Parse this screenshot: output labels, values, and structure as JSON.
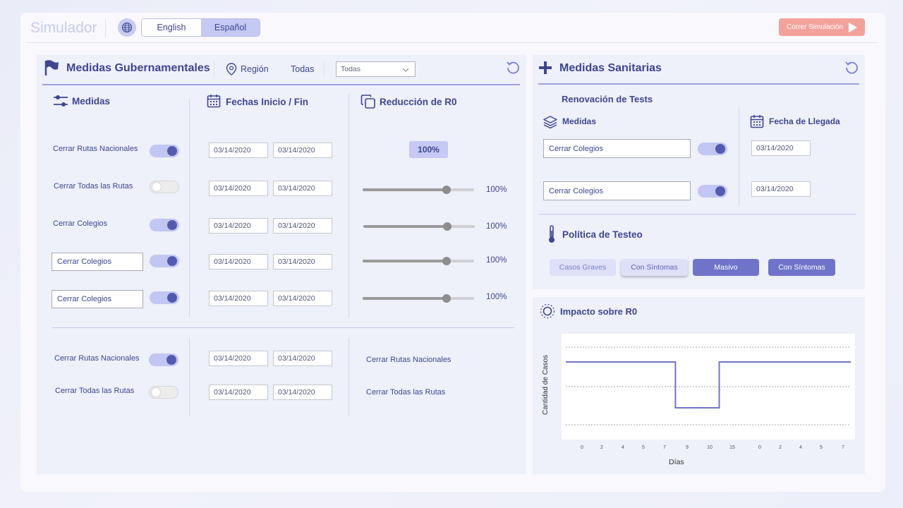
{
  "header": {
    "app_title": "Simulador",
    "language_options": [
      "English",
      "Español"
    ],
    "selected_language": "Español",
    "run_button_label": "Correr Simulación"
  },
  "gov": {
    "title": "Medidas Gubernamentales",
    "region_label": "Región",
    "region_value": "Todas",
    "region_select_value": "Todas",
    "col_measures": "Medidas",
    "col_dates": "Fechas Inicio / Fin",
    "col_reduction": "Reducción de R0",
    "rows": [
      {
        "label": "Cerrar Rutas Nacionales",
        "toggle": "on",
        "start": "03/14/2020",
        "end": "03/14/2020",
        "pct_badge": "100%"
      },
      {
        "label": "Cerrar Todas las Rutas",
        "toggle": "off",
        "start": "03/14/2020",
        "end": "03/14/2020",
        "slider": 0.75,
        "pct": "100%"
      },
      {
        "label": "Cerrar Colegios",
        "toggle": "on",
        "start": "03/14/2020",
        "end": "03/14/2020",
        "slider": 0.75,
        "pct": "100%"
      },
      {
        "input_value": "Cerrar Colegios",
        "toggle": "on",
        "start": "03/14/2020",
        "end": "03/14/2020",
        "slider": 0.75,
        "pct": "100%"
      },
      {
        "input_value": "Cerrar Colegios",
        "toggle": "on",
        "start": "03/14/2020",
        "end": "03/14/2020",
        "slider": 0.75,
        "pct": "100%"
      }
    ],
    "bottom_rows": [
      {
        "label": "Cerrar Rutas Nacionales",
        "toggle": "on",
        "start": "03/14/2020",
        "end": "03/14/2020",
        "right_label": "Cerrar Rutas Nacionales"
      },
      {
        "label": "Cerrar Todas las Rutas",
        "toggle": "off",
        "start": "03/14/2020",
        "end": "03/14/2020",
        "right_label": "Cerrar Todas las Rutas"
      }
    ]
  },
  "health": {
    "title": "Medidas Sanitarias",
    "subtitle": "Renovación de Tests",
    "col_measures": "Medidas",
    "col_date": "Fecha de Llegada",
    "rows": [
      {
        "input_value": "Cerrar Colegios",
        "toggle": "on",
        "date": "03/14/2020"
      },
      {
        "input_value": "Cerrar Colegios",
        "toggle": "on",
        "date": "03/14/2020"
      }
    ],
    "policy_title": "Política de Testeo",
    "policy_buttons": [
      "Casos Graves",
      "Con Síntomas",
      "Masivo",
      "Con Síntomas"
    ]
  },
  "impact": {
    "title": "Impacto sobre R0"
  },
  "chart_data": {
    "type": "line",
    "title": "",
    "xlabel": "Días",
    "ylabel": "Cantidad de Casos",
    "x_tick_labels": [
      "0",
      "2",
      "4",
      "5",
      "7",
      "9",
      "10",
      "15",
      "0",
      "2",
      "4",
      "5",
      "7"
    ],
    "series": [
      {
        "values": [
          2,
          2,
          2,
          2,
          2,
          0.7,
          0.7,
          2,
          2,
          2,
          2,
          2,
          2,
          2
        ]
      }
    ],
    "ylim": [
      0,
      3
    ],
    "grid": "horizontal dashed",
    "color": "#6f74c9"
  },
  "colors": {
    "accent": "#535ab0",
    "accent_light": "#c5c9f3",
    "run_button": "#f3a29b",
    "panel_bg": "#eef0fa",
    "text": "#3e4690"
  }
}
